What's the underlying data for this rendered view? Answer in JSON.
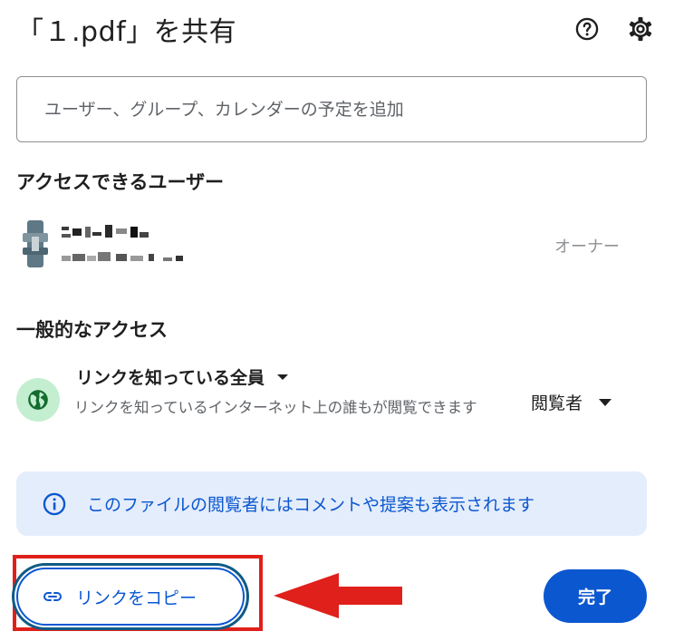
{
  "dialog": {
    "title": "「１.pdf」を共有"
  },
  "icons": {
    "help": "help-circle-icon",
    "settings": "gear-icon",
    "globe": "globe-icon",
    "info": "info-icon",
    "link": "link-icon"
  },
  "share_input": {
    "placeholder": "ユーザー、グループ、カレンダーの予定を追加"
  },
  "people_section": {
    "heading": "アクセスできるユーザー",
    "owner": {
      "role": "オーナー"
    }
  },
  "general_access": {
    "heading": "一般的なアクセス",
    "scope_label": "リンクを知っている全員",
    "description": "リンクを知っているインターネット上の誰もが閲覧できます",
    "role_label": "閲覧者"
  },
  "info_banner": {
    "text": "このファイルの閲覧者にはコメントや提案も表示されます"
  },
  "footer": {
    "copy_link_label": "リンクをコピー",
    "done_label": "完了"
  },
  "colors": {
    "accent": "#0b57d0",
    "info_bg": "#e4edfb",
    "globe_bg": "#c4eed0",
    "annotation_red": "#e0201a"
  }
}
